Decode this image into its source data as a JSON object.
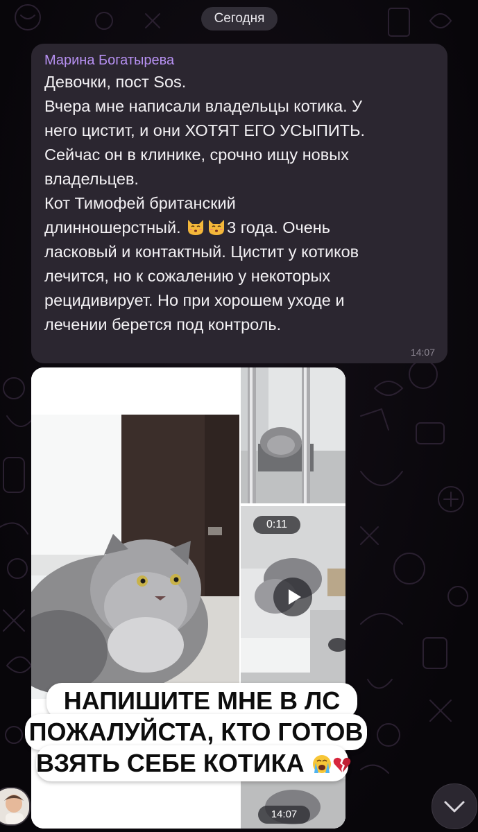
{
  "date_separator": "Сегодня",
  "message": {
    "sender": "Марина Богатырева",
    "lines": [
      "Девочки, пост Sos.",
      "Вчера мне написали владельцы котика. У",
      "него цистит, и они ХОТЯТ ЕГО УСЫПИТЬ.",
      "Сейчас он в клинике, срочно ищу новых",
      "владельцев.",
      "Кот Тимофей британский",
      "длинношерстный.",
      "3 года. Очень",
      "ласковый и контактный. Цистит у котиков",
      "лечится, но к сожалению у некоторых",
      "рецидивирует. Но при хорошем уходе и",
      "лечении берется под контроль."
    ],
    "emoji": "kissing-cat-face-icon",
    "time": "14:07"
  },
  "album": {
    "video_duration": "0:11",
    "time": "14:07"
  },
  "caption": {
    "line1": "НАПИШИТЕ МНЕ В ЛС",
    "line2": "ПОЖАЛУЙСТА, КТО ГОТОВ",
    "line3": "ВЗЯТЬ СЕБЕ КОТИКА",
    "emojis": [
      "loudly-crying-face-icon",
      "broken-heart-icon"
    ]
  },
  "colors": {
    "background": "#0a070c",
    "bubble": "#2b2630",
    "sender_name": "#b690f1",
    "message_text": "#f3f1f4"
  }
}
